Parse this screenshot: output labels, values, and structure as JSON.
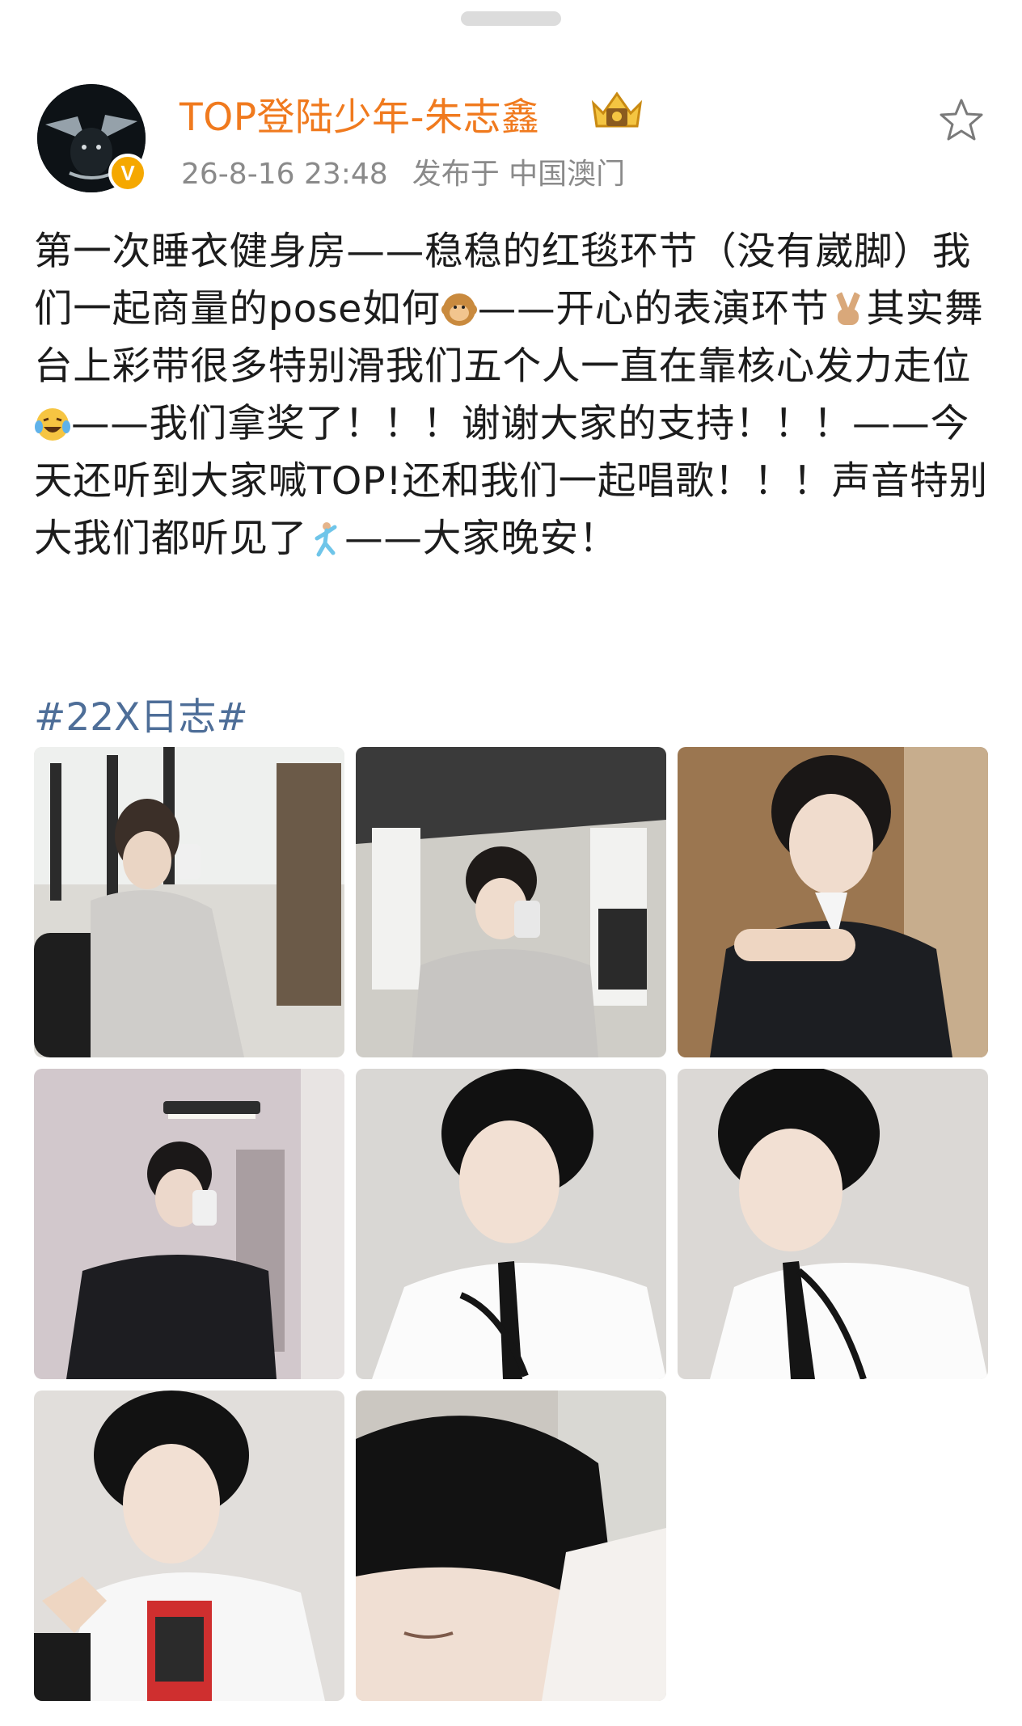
{
  "post": {
    "author": "TOP登陆少年-朱志鑫",
    "verified_badge": "V",
    "timestamp": "26-8-16 23:48",
    "location": "发布于 中国澳门",
    "content_segments": [
      "第一次睡衣健身房——稳稳的红毯环节（没有崴脚）我们一起商量的pose如何",
      "——开心的表演环节",
      "其实舞台上彩带很多特别滑我们五个人一直在靠核心发力走位",
      "——我们拿奖了！！！谢谢大家的支持！！！——今天还听到大家喊TOP!还和我们一起唱歌！！！声音特别大我们都听见了",
      "——大家晚安！"
    ],
    "topic": "#22X日志#"
  },
  "icons": [
    "drag-handle",
    "avatar",
    "verified-icon",
    "crown-badge-icon",
    "star-favorite-icon",
    "monkey-emoji",
    "victory-hand-emoji",
    "laughing-tears-emoji",
    "dancing-man-emoji"
  ],
  "photos": [
    {
      "name": "photo-gym-mirror-selfie-1",
      "bg": "#c9c6c0"
    },
    {
      "name": "photo-gym-mirror-selfie-2",
      "bg": "#b7b7b2"
    },
    {
      "name": "photo-black-suit-pointing",
      "bg": "#a07a52"
    },
    {
      "name": "photo-suit-mirror-selfie",
      "bg": "#c9bcc0"
    },
    {
      "name": "photo-white-shirt-tie-1",
      "bg": "#d2d0cd"
    },
    {
      "name": "photo-white-shirt-tie-2",
      "bg": "#d4d1ce"
    },
    {
      "name": "photo-white-jacket-peace",
      "bg": "#dad7d4"
    },
    {
      "name": "photo-closeup-eyes-closed",
      "bg": "#cfcbc6"
    }
  ]
}
